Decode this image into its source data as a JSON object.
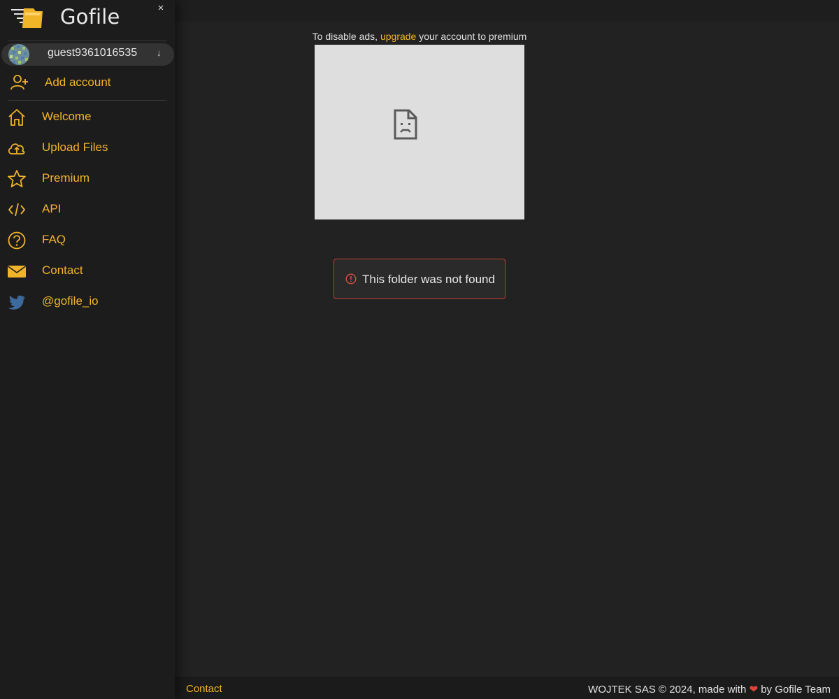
{
  "brand": {
    "name": "Gofile",
    "close_glyph": "×"
  },
  "account": {
    "username": "guest9361016535",
    "arrow_glyph": "↓"
  },
  "add_account": {
    "label": "Add account",
    "icon": "user-plus-icon"
  },
  "nav": {
    "items": [
      {
        "label": "Welcome",
        "icon": "home-icon"
      },
      {
        "label": "Upload Files",
        "icon": "cloud-upload-icon"
      },
      {
        "label": "Premium",
        "icon": "star-icon"
      },
      {
        "label": "API",
        "icon": "code-icon"
      },
      {
        "label": "FAQ",
        "icon": "question-circle-icon"
      },
      {
        "label": "Contact",
        "icon": "envelope-icon"
      },
      {
        "label": "@gofile_io",
        "icon": "twitter-icon"
      }
    ]
  },
  "ads": {
    "prefix": "To disable ads,",
    "link_text": "upgrade",
    "suffix": "your account to premium"
  },
  "alert": {
    "message": "This folder was not found",
    "icon": "exclamation-circle-icon"
  },
  "footer": {
    "contact_label": "Contact",
    "credit_prefix": "WOJTEK SAS © 2024, made with",
    "heart_glyph": "❤",
    "credit_suffix": "by Gofile Team"
  },
  "colors": {
    "accent": "#f0b429",
    "background": "#222222",
    "sidebar": "#1c1c1c",
    "alert_border": "#c0402f",
    "twitter": "#3d6a9c"
  }
}
